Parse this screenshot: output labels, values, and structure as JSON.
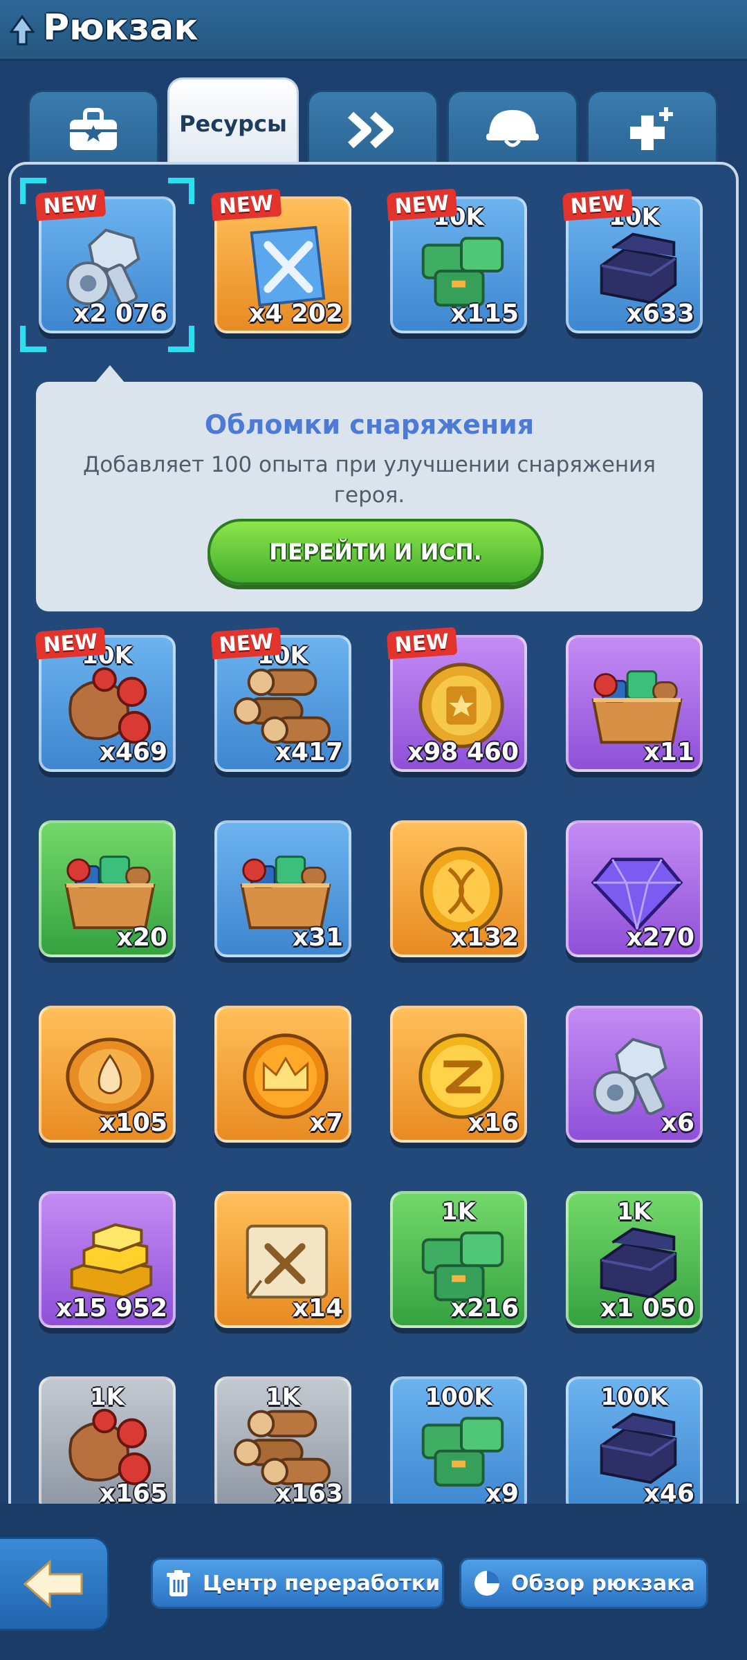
{
  "header": {
    "title": "Рюкзак"
  },
  "tabs": [
    {
      "id": "equipment",
      "label": "",
      "icon": "bag-star-icon"
    },
    {
      "id": "resources",
      "label": "Ресурсы",
      "active": true
    },
    {
      "id": "speedups",
      "label": "",
      "icon": "double-chevron-icon"
    },
    {
      "id": "helmet",
      "label": "",
      "icon": "helmet-icon"
    },
    {
      "id": "boosts",
      "label": "",
      "icon": "cross-plus-icon"
    }
  ],
  "new_badge": "NEW",
  "tooltip": {
    "title": "Обломки снаряжения",
    "description": "Добавляет 100 опыта при улучшении снаряжения героя.",
    "button": "ПЕРЕЙТИ И ИСП."
  },
  "items": [
    {
      "name": "equipment-scraps",
      "icon": "bolt-nut-icon",
      "color": "blue",
      "count": "x2 076",
      "tier": "",
      "new": true,
      "selected": true
    },
    {
      "name": "hero-skill-book",
      "icon": "crossed-swords-book-icon",
      "color": "orange",
      "count": "x4 202",
      "tier": "",
      "new": true
    },
    {
      "name": "supplies-10k",
      "icon": "green-crates-icon",
      "color": "blue",
      "count": "x115",
      "tier": "10K",
      "new": true
    },
    {
      "name": "iron-10k",
      "icon": "iron-ingot-icon",
      "color": "blue",
      "count": "x633",
      "tier": "10K",
      "new": true
    },
    {
      "name": "food-10k",
      "icon": "food-sack-icon",
      "color": "blue",
      "count": "x469",
      "tier": "10K",
      "new": true
    },
    {
      "name": "wood-10k",
      "icon": "log-stack-icon",
      "color": "blue",
      "count": "x417",
      "tier": "10K",
      "new": true
    },
    {
      "name": "gold-coin",
      "icon": "star-coin-icon",
      "color": "purple",
      "count": "x98 460",
      "tier": "",
      "new": true
    },
    {
      "name": "resource-chest-purple",
      "icon": "resource-crate-icon",
      "color": "purple",
      "count": "x11",
      "tier": "",
      "new": false
    },
    {
      "name": "resource-chest-green",
      "icon": "resource-crate-icon",
      "color": "green",
      "count": "x20",
      "tier": "",
      "new": false
    },
    {
      "name": "resource-chest-blue",
      "icon": "resource-crate-icon",
      "color": "blue",
      "count": "x31",
      "tier": "",
      "new": false
    },
    {
      "name": "dna-coin",
      "icon": "dna-coin-icon",
      "color": "orange",
      "count": "x132",
      "tier": "",
      "new": false
    },
    {
      "name": "purple-gem",
      "icon": "gem-icon",
      "color": "purple",
      "count": "x270",
      "tier": "",
      "new": false
    },
    {
      "name": "drop-coin",
      "icon": "drop-coin-icon",
      "color": "orange",
      "count": "x105",
      "tier": "",
      "new": false
    },
    {
      "name": "crown-coin",
      "icon": "crown-coin-icon",
      "color": "orange",
      "count": "x7",
      "tier": "",
      "new": false
    },
    {
      "name": "z-coin",
      "icon": "z-coin-icon",
      "color": "orange",
      "count": "x16",
      "tier": "",
      "new": false
    },
    {
      "name": "equipment-scraps-purple",
      "icon": "bolt-nut-icon",
      "color": "purple",
      "count": "x6",
      "tier": "",
      "new": false
    },
    {
      "name": "gold-bars",
      "icon": "gold-bars-icon",
      "color": "purple",
      "count": "x15 952",
      "tier": "",
      "new": false
    },
    {
      "name": "blueprint",
      "icon": "blueprint-scroll-icon",
      "color": "orange",
      "count": "x14",
      "tier": "",
      "new": false
    },
    {
      "name": "supplies-1k",
      "icon": "green-crates-icon",
      "color": "green",
      "count": "x216",
      "tier": "1K",
      "new": false
    },
    {
      "name": "iron-1k",
      "icon": "iron-ingot-icon",
      "color": "green",
      "count": "x1 050",
      "tier": "1K",
      "new": false
    },
    {
      "name": "food-1k",
      "icon": "food-sack-icon",
      "color": "grey",
      "count": "x165",
      "tier": "1K",
      "new": false
    },
    {
      "name": "wood-1k",
      "icon": "log-stack-icon",
      "color": "grey",
      "count": "x163",
      "tier": "1K",
      "new": false
    },
    {
      "name": "supplies-100k",
      "icon": "green-crates-icon",
      "color": "blue",
      "count": "x9",
      "tier": "100K",
      "new": false
    },
    {
      "name": "iron-100k",
      "icon": "iron-ingot-icon",
      "color": "blue",
      "count": "x46",
      "tier": "100K",
      "new": false
    }
  ],
  "footer": {
    "recycle_label": "Центр переработки",
    "overview_label": "Обзор рюкзака"
  }
}
